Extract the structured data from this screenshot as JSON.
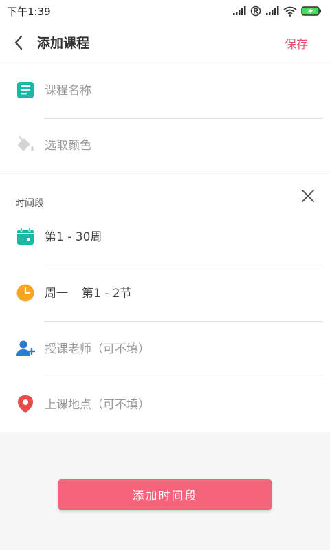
{
  "status_bar": {
    "time": "下午1:39"
  },
  "app_bar": {
    "title": "添加课程",
    "save_label": "保存"
  },
  "course": {
    "name_placeholder": "课程名称",
    "color_placeholder": "选取颜色"
  },
  "time_slot": {
    "label": "时间段",
    "weeks": "第1 - 30周",
    "day": "周一",
    "sections": "第1 - 2节",
    "teacher_placeholder": "授课老师（可不填）",
    "location_placeholder": "上课地点（可不填）"
  },
  "add_button_label": "添加时间段",
  "colors": {
    "accent": "#f0506e",
    "teal": "#1ab8a8",
    "orange": "#f6a623",
    "blue": "#2b7cd6",
    "red": "#e94b4b"
  }
}
